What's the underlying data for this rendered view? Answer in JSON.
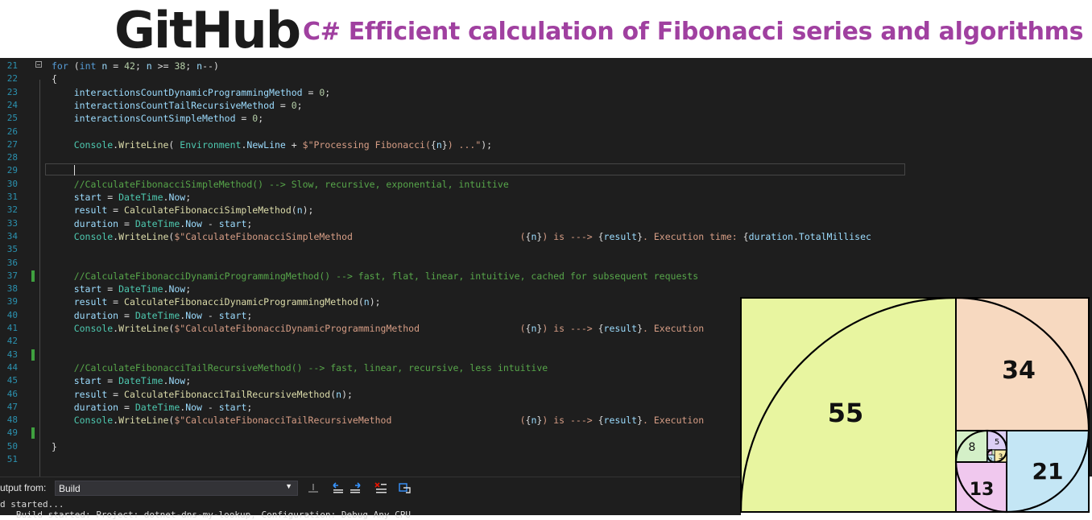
{
  "banner": {
    "logo_text": "GitHub",
    "title": "C# Efficient calculation of Fibonacci series and algorithms",
    "title_color": "#a040a0"
  },
  "editor": {
    "theme_background": "#1e1e1e",
    "lines": [
      {
        "n": "21",
        "tokens": [
          [
            "kw",
            "for"
          ],
          [
            "p",
            " ("
          ],
          [
            "kw",
            "int"
          ],
          [
            "p",
            " "
          ],
          [
            "var",
            "n"
          ],
          [
            "p",
            " = "
          ],
          [
            "num",
            "42"
          ],
          [
            "p",
            "; "
          ],
          [
            "var",
            "n"
          ],
          [
            "p",
            " >= "
          ],
          [
            "num",
            "38"
          ],
          [
            "p",
            "; "
          ],
          [
            "var",
            "n"
          ],
          [
            "p",
            "--)"
          ]
        ]
      },
      {
        "n": "22",
        "tokens": [
          [
            "p",
            "{"
          ]
        ]
      },
      {
        "n": "23",
        "tokens": [
          [
            "p",
            "    "
          ],
          [
            "var",
            "interactionsCountDynamicProgrammingMethod"
          ],
          [
            "p",
            " = "
          ],
          [
            "num",
            "0"
          ],
          [
            "p",
            ";"
          ]
        ]
      },
      {
        "n": "24",
        "tokens": [
          [
            "p",
            "    "
          ],
          [
            "var",
            "interactionsCountTailRecursiveMethod"
          ],
          [
            "p",
            " = "
          ],
          [
            "num",
            "0"
          ],
          [
            "p",
            ";"
          ]
        ]
      },
      {
        "n": "25",
        "tokens": [
          [
            "p",
            "    "
          ],
          [
            "var",
            "interactionsCountSimpleMethod"
          ],
          [
            "p",
            " = "
          ],
          [
            "num",
            "0"
          ],
          [
            "p",
            ";"
          ]
        ]
      },
      {
        "n": "26",
        "tokens": []
      },
      {
        "n": "27",
        "tokens": [
          [
            "p",
            "    "
          ],
          [
            "ty",
            "Console"
          ],
          [
            "p",
            "."
          ],
          [
            "mth",
            "WriteLine"
          ],
          [
            "p",
            "( "
          ],
          [
            "ty",
            "Environment"
          ],
          [
            "p",
            "."
          ],
          [
            "var",
            "NewLine"
          ],
          [
            "p",
            " + "
          ],
          [
            "str",
            "$\"Processing Fibonacci("
          ],
          [
            "p",
            "{"
          ],
          [
            "var",
            "n"
          ],
          [
            "p",
            "}"
          ],
          [
            "str",
            ") ...\""
          ],
          [
            "p",
            ");"
          ]
        ]
      },
      {
        "n": "28",
        "tokens": []
      },
      {
        "n": "29",
        "tokens": []
      },
      {
        "n": "30",
        "tokens": [
          [
            "p",
            "    "
          ],
          [
            "cmt",
            "//CalculateFibonacciSimpleMethod() --> Slow, recursive, exponential, intuitive"
          ]
        ]
      },
      {
        "n": "31",
        "tokens": [
          [
            "p",
            "    "
          ],
          [
            "var",
            "start"
          ],
          [
            "p",
            " = "
          ],
          [
            "ty",
            "DateTime"
          ],
          [
            "p",
            "."
          ],
          [
            "var",
            "Now"
          ],
          [
            "p",
            ";"
          ]
        ]
      },
      {
        "n": "32",
        "tokens": [
          [
            "p",
            "    "
          ],
          [
            "var",
            "result"
          ],
          [
            "p",
            " = "
          ],
          [
            "mth",
            "CalculateFibonacciSimpleMethod"
          ],
          [
            "p",
            "("
          ],
          [
            "var",
            "n"
          ],
          [
            "p",
            ");"
          ]
        ]
      },
      {
        "n": "33",
        "tokens": [
          [
            "p",
            "    "
          ],
          [
            "var",
            "duration"
          ],
          [
            "p",
            " = "
          ],
          [
            "ty",
            "DateTime"
          ],
          [
            "p",
            "."
          ],
          [
            "var",
            "Now"
          ],
          [
            "p",
            " - "
          ],
          [
            "var",
            "start"
          ],
          [
            "p",
            ";"
          ]
        ]
      },
      {
        "n": "34",
        "tokens": [
          [
            "p",
            "    "
          ],
          [
            "ty",
            "Console"
          ],
          [
            "p",
            "."
          ],
          [
            "mth",
            "WriteLine"
          ],
          [
            "p",
            "("
          ],
          [
            "str",
            "$\"CalculateFibonacciSimpleMethod                              ("
          ],
          [
            "p",
            "{"
          ],
          [
            "var",
            "n"
          ],
          [
            "p",
            "}"
          ],
          [
            "str",
            ") is ---> "
          ],
          [
            "p",
            "{"
          ],
          [
            "var",
            "result"
          ],
          [
            "p",
            "}"
          ],
          [
            "str",
            ". Execution time: "
          ],
          [
            "p",
            "{"
          ],
          [
            "var",
            "duration"
          ],
          [
            "p",
            "."
          ],
          [
            "var",
            "TotalMillisec"
          ]
        ]
      },
      {
        "n": "35",
        "tokens": []
      },
      {
        "n": "36",
        "tokens": []
      },
      {
        "n": "37",
        "tokens": [
          [
            "p",
            "    "
          ],
          [
            "cmt",
            "//CalculateFibonacciDynamicProgrammingMethod() --> fast, flat, linear, intuitive, cached for subsequent requests"
          ]
        ],
        "changed": true
      },
      {
        "n": "38",
        "tokens": [
          [
            "p",
            "    "
          ],
          [
            "var",
            "start"
          ],
          [
            "p",
            " = "
          ],
          [
            "ty",
            "DateTime"
          ],
          [
            "p",
            "."
          ],
          [
            "var",
            "Now"
          ],
          [
            "p",
            ";"
          ]
        ]
      },
      {
        "n": "39",
        "tokens": [
          [
            "p",
            "    "
          ],
          [
            "var",
            "result"
          ],
          [
            "p",
            " = "
          ],
          [
            "mth",
            "CalculateFibonacciDynamicProgrammingMethod"
          ],
          [
            "p",
            "("
          ],
          [
            "var",
            "n"
          ],
          [
            "p",
            ");"
          ]
        ]
      },
      {
        "n": "40",
        "tokens": [
          [
            "p",
            "    "
          ],
          [
            "var",
            "duration"
          ],
          [
            "p",
            " = "
          ],
          [
            "ty",
            "DateTime"
          ],
          [
            "p",
            "."
          ],
          [
            "var",
            "Now"
          ],
          [
            "p",
            " - "
          ],
          [
            "var",
            "start"
          ],
          [
            "p",
            ";"
          ]
        ]
      },
      {
        "n": "41",
        "tokens": [
          [
            "p",
            "    "
          ],
          [
            "ty",
            "Console"
          ],
          [
            "p",
            "."
          ],
          [
            "mth",
            "WriteLine"
          ],
          [
            "p",
            "("
          ],
          [
            "str",
            "$\"CalculateFibonacciDynamicProgrammingMethod                  ("
          ],
          [
            "p",
            "{"
          ],
          [
            "var",
            "n"
          ],
          [
            "p",
            "}"
          ],
          [
            "str",
            ") is ---> "
          ],
          [
            "p",
            "{"
          ],
          [
            "var",
            "result"
          ],
          [
            "p",
            "}"
          ],
          [
            "str",
            ". Execution "
          ]
        ]
      },
      {
        "n": "42",
        "tokens": []
      },
      {
        "n": "43",
        "tokens": [],
        "changed": true
      },
      {
        "n": "44",
        "tokens": [
          [
            "p",
            "    "
          ],
          [
            "cmt",
            "//CalculateFibonacciTailRecursiveMethod() --> fast, linear, recursive, less intuitive"
          ]
        ]
      },
      {
        "n": "45",
        "tokens": [
          [
            "p",
            "    "
          ],
          [
            "var",
            "start"
          ],
          [
            "p",
            " = "
          ],
          [
            "ty",
            "DateTime"
          ],
          [
            "p",
            "."
          ],
          [
            "var",
            "Now"
          ],
          [
            "p",
            ";"
          ]
        ]
      },
      {
        "n": "46",
        "tokens": [
          [
            "p",
            "    "
          ],
          [
            "var",
            "result"
          ],
          [
            "p",
            " = "
          ],
          [
            "mth",
            "CalculateFibonacciTailRecursiveMethod"
          ],
          [
            "p",
            "("
          ],
          [
            "var",
            "n"
          ],
          [
            "p",
            ");"
          ]
        ]
      },
      {
        "n": "47",
        "tokens": [
          [
            "p",
            "    "
          ],
          [
            "var",
            "duration"
          ],
          [
            "p",
            " = "
          ],
          [
            "ty",
            "DateTime"
          ],
          [
            "p",
            "."
          ],
          [
            "var",
            "Now"
          ],
          [
            "p",
            " - "
          ],
          [
            "var",
            "start"
          ],
          [
            "p",
            ";"
          ]
        ]
      },
      {
        "n": "48",
        "tokens": [
          [
            "p",
            "    "
          ],
          [
            "ty",
            "Console"
          ],
          [
            "p",
            "."
          ],
          [
            "mth",
            "WriteLine"
          ],
          [
            "p",
            "("
          ],
          [
            "str",
            "$\"CalculateFibonacciTailRecursiveMethod                       ("
          ],
          [
            "p",
            "{"
          ],
          [
            "var",
            "n"
          ],
          [
            "p",
            "}"
          ],
          [
            "str",
            ") is ---> "
          ],
          [
            "p",
            "{"
          ],
          [
            "var",
            "result"
          ],
          [
            "p",
            "}"
          ],
          [
            "str",
            ". Execution "
          ]
        ]
      },
      {
        "n": "49",
        "tokens": [],
        "changed": true
      },
      {
        "n": "50",
        "tokens": [
          [
            "p",
            "}"
          ]
        ]
      },
      {
        "n": "51",
        "tokens": []
      }
    ]
  },
  "output_panel": {
    "label": "utput from:",
    "source": "Build",
    "line1": "d started...",
    "line2": "   Build started: Project: dotnet-dns-my-lookup, Configuration: Debug Any CPU"
  },
  "fibonacci_tiles": {
    "labels": [
      "55",
      "34",
      "21",
      "13",
      "8",
      "5",
      "3",
      "2"
    ],
    "colors": {
      "t55": "#e8f5a0",
      "t34": "#f7d9c0",
      "t21": "#c4e6f5",
      "t13": "#f0c8ee",
      "t8": "#d4f0c8",
      "t5": "#dccff5",
      "t3": "#f5e9a8"
    }
  }
}
